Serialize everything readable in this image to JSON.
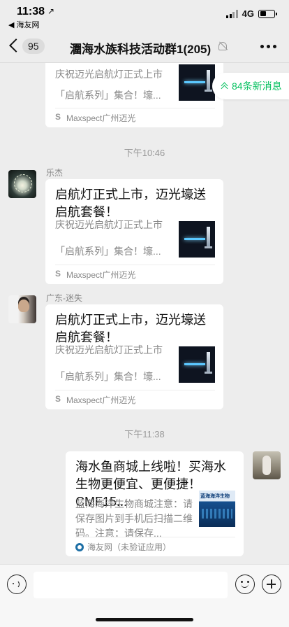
{
  "status_bar": {
    "time": "11:38",
    "location_arrow": "↗",
    "back_app": "◀ 海友网",
    "network": "4G"
  },
  "nav": {
    "unread_count": "95",
    "title": "潿海水族科技活动群1(205)"
  },
  "new_messages_label": "84条新消息",
  "messages": [
    {
      "type": "partial_card",
      "desc1": "庆祝迈光启航灯正式上市",
      "desc2": "「启航系列」集合！壕...",
      "source": "Maxspect广州迈光"
    },
    {
      "type": "time",
      "text": "下午10:46"
    },
    {
      "type": "card",
      "sender": "乐杰",
      "title": "启航灯正式上市，迈光壕送启航套餐！",
      "desc1": "庆祝迈光启航灯正式上市",
      "desc2": "「启航系列」集合！壕...",
      "source": "Maxspect广州迈光"
    },
    {
      "type": "card",
      "sender": "广东-迷失",
      "title": "启航灯正式上市，迈光壕送启航套餐！",
      "desc1": "庆祝迈光启航灯正式上市",
      "desc2": "「启航系列」集合！壕...",
      "source": "Maxspect广州迈光"
    },
    {
      "type": "time",
      "text": "下午11:38"
    },
    {
      "type": "card_self",
      "title": "海水鱼商城上线啦！买海水生物更便宜、更便捷！CMF15...",
      "desc": "蓝海海洋生物商城注意：请保存图片到手机后扫描二维码。注意：请保存...",
      "thumb_text": "蓝海海洋生物",
      "source": "海友网（未验证应用）"
    }
  ],
  "colors": {
    "background": "#ededed",
    "accent_green": "#07c160",
    "bubble": "#ffffff"
  }
}
